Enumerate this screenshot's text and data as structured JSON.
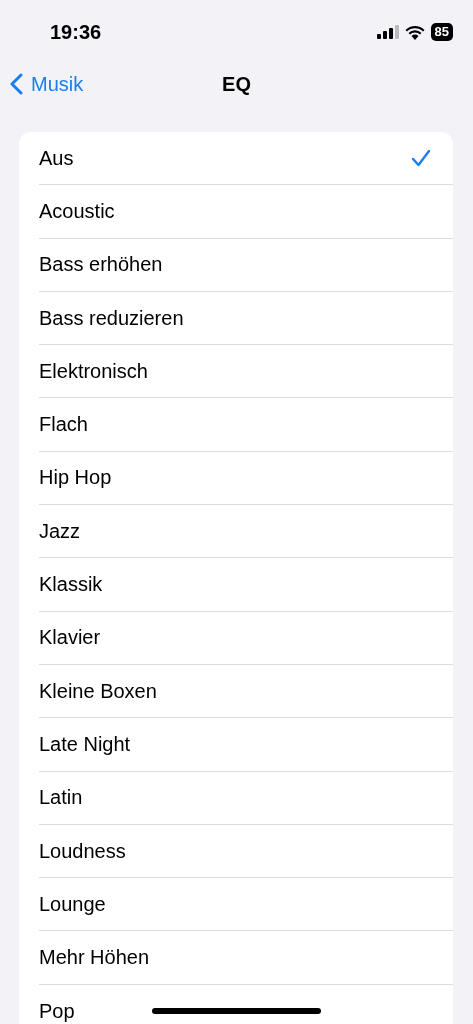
{
  "status_bar": {
    "time": "19:36",
    "battery": "85"
  },
  "nav": {
    "back": "Musik",
    "title": "EQ"
  },
  "items": [
    {
      "label": "Aus",
      "selected": true
    },
    {
      "label": "Acoustic",
      "selected": false
    },
    {
      "label": "Bass erhöhen",
      "selected": false
    },
    {
      "label": "Bass reduzieren",
      "selected": false
    },
    {
      "label": "Elektronisch",
      "selected": false
    },
    {
      "label": "Flach",
      "selected": false
    },
    {
      "label": "Hip Hop",
      "selected": false
    },
    {
      "label": "Jazz",
      "selected": false
    },
    {
      "label": "Klassik",
      "selected": false
    },
    {
      "label": "Klavier",
      "selected": false
    },
    {
      "label": "Kleine Boxen",
      "selected": false
    },
    {
      "label": "Late Night",
      "selected": false
    },
    {
      "label": "Latin",
      "selected": false
    },
    {
      "label": "Loudness",
      "selected": false
    },
    {
      "label": "Lounge",
      "selected": false
    },
    {
      "label": "Mehr Höhen",
      "selected": false
    },
    {
      "label": "Pop",
      "selected": false
    }
  ]
}
